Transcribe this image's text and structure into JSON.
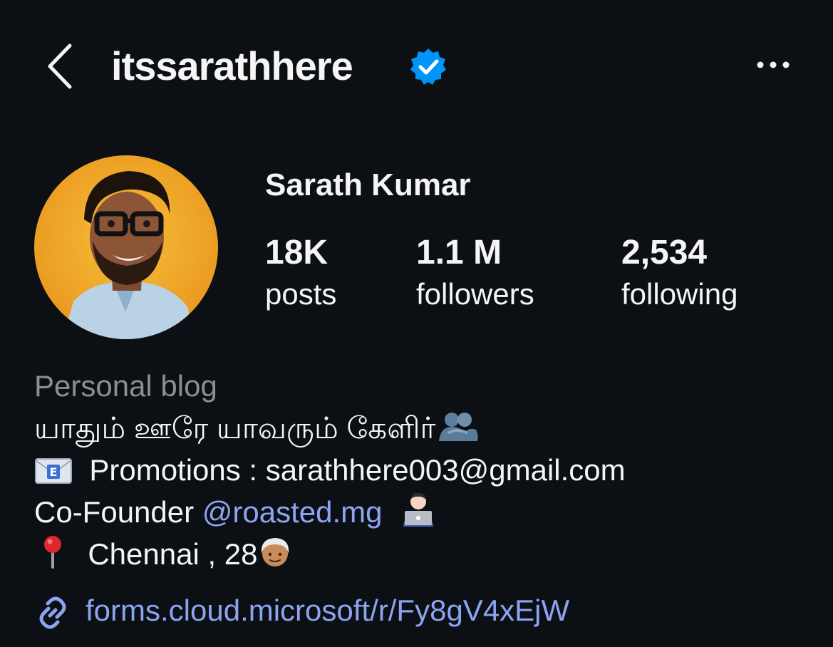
{
  "header": {
    "username": "itssarathhere",
    "verified": true
  },
  "profile": {
    "display_name": "Sarath Kumar",
    "stats": [
      {
        "value": "18K",
        "label": "posts"
      },
      {
        "value": "1.1 M",
        "label": "followers"
      },
      {
        "value": "2,534",
        "label": "following"
      }
    ]
  },
  "bio": {
    "category": "Personal blog",
    "tamil_line": "யாதும் ஊரே யாவரும் கேளிர்",
    "email_line": "Promotions : sarathhere003@gmail.com",
    "founder_prefix": "Co-Founder ",
    "founder_mention": "@roasted.mg",
    "location_line": "Chennai , 28"
  },
  "link": {
    "url": "forms.cloud.microsoft/r/Fy8gV4xEjW"
  },
  "colors": {
    "background": "#0c1014",
    "verified_badge": "#0095f6",
    "link": "#8da4f1",
    "category": "#8e8e8e",
    "avatar_bg": "#f2a92d"
  }
}
